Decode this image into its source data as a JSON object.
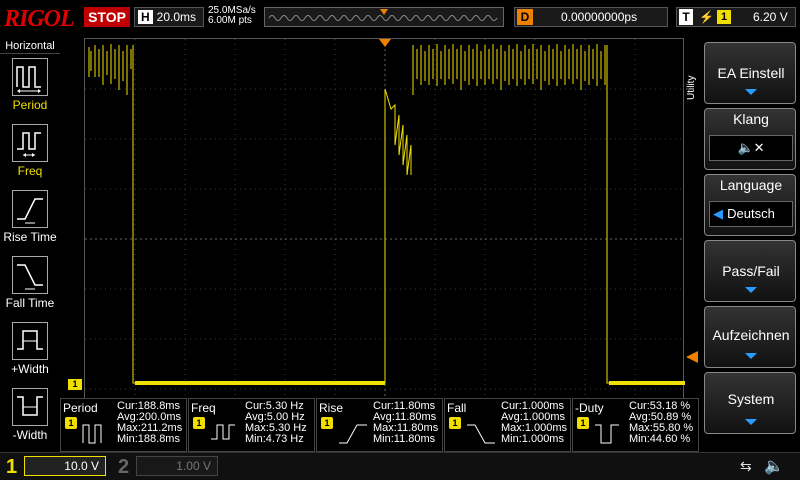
{
  "brand": "RIGOL",
  "status": "STOP",
  "horizontal": {
    "letter": "H",
    "timebase": "20.0ms",
    "sample_rate": "25.0MSa/s",
    "memory_depth": "6.00M pts"
  },
  "delay": {
    "letter": "D",
    "value": "0.00000000ps"
  },
  "trigger": {
    "letter": "T",
    "edge_icon": "rising-edge-icon",
    "source": "1",
    "level": "6.20 V"
  },
  "left_menu": {
    "title": "Horizontal",
    "items": [
      {
        "label": "Period",
        "icon": "period-icon"
      },
      {
        "label": "Freq",
        "icon": "freq-icon"
      },
      {
        "label": "Rise Time",
        "icon": "rise-time-icon"
      },
      {
        "label": "Fall Time",
        "icon": "fall-time-icon"
      },
      {
        "label": "+Width",
        "icon": "plus-width-icon"
      },
      {
        "label": "-Width",
        "icon": "minus-width-icon"
      }
    ]
  },
  "right_menu": {
    "title": "Utility",
    "items": [
      {
        "label": "EA Einstell"
      },
      {
        "label": "Klang",
        "value_icon": "speaker-muted-icon"
      },
      {
        "label": "Language",
        "value": "Deutsch"
      },
      {
        "label": "Pass/Fail"
      },
      {
        "label": "Aufzeichnen"
      },
      {
        "label": "System"
      }
    ]
  },
  "channel_marker": "1",
  "measurements": [
    {
      "name": "Period",
      "channel": "1",
      "cur": "Cur:188.8ms",
      "avg": "Avg:200.0ms",
      "max": "Max:211.2ms",
      "min": "Min:188.8ms"
    },
    {
      "name": "Freq",
      "channel": "1",
      "cur": "Cur:5.30 Hz",
      "avg": "Avg:5.00 Hz",
      "max": "Max:5.30 Hz",
      "min": "Min:4.73 Hz"
    },
    {
      "name": "Rise",
      "channel": "1",
      "cur": "Cur:11.80ms",
      "avg": "Avg:11.80ms",
      "max": "Max:11.80ms",
      "min": "Min:11.80ms"
    },
    {
      "name": "Fall",
      "channel": "1",
      "cur": "Cur:1.000ms",
      "avg": "Avg:1.000ms",
      "max": "Max:1.000ms",
      "min": "Min:1.000ms"
    },
    {
      "name": "-Duty",
      "channel": "1",
      "cur": "Cur:53.18 %",
      "avg": "Avg:50.89 %",
      "max": "Max:55.80 %",
      "min": "Min:44.60 %"
    }
  ],
  "channels": [
    {
      "num": "1",
      "scale": "10.0 V",
      "active": true
    },
    {
      "num": "2",
      "scale": "1.00 V",
      "active": false
    }
  ],
  "colors": {
    "ch1": "#f0e000",
    "trigger": "#f08000",
    "stop": "#c00000",
    "accent": "#2a9bff"
  }
}
